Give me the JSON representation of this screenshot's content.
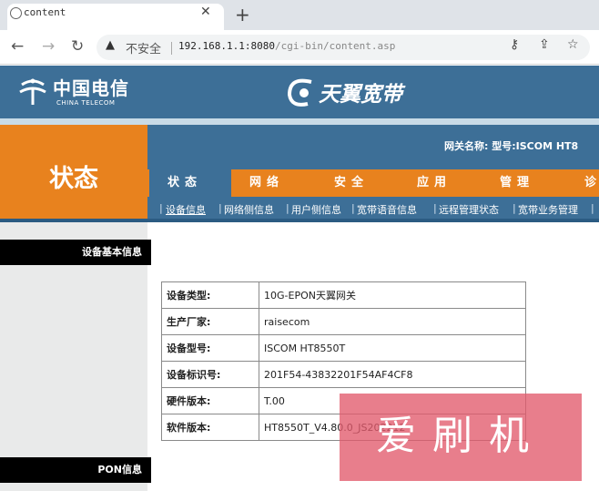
{
  "browser": {
    "tab_title": "content",
    "security_text": "不安全",
    "url_host": "192.168.1.1:8080",
    "url_path": "/cgi-bin/content.asp"
  },
  "header": {
    "logo_cn": "中国电信",
    "logo_en": "CHINA TELECOM",
    "brand": "天翼宽带"
  },
  "status_label": "状态",
  "gateway_info": "网关名称:   型号:ISCOM HT8",
  "nav": {
    "tabs": [
      "状态",
      "网络",
      "安全",
      "应用",
      "管理",
      "诊"
    ],
    "subtabs": [
      "设备信息",
      "网络侧信息",
      "用户侧信息",
      "宽带语音信息",
      "远程管理状态",
      "宽带业务管理"
    ]
  },
  "sidebar": {
    "sections": [
      "设备基本信息",
      "PON信息"
    ]
  },
  "device_info": {
    "rows": [
      {
        "label": "设备类型:",
        "value": "10G-EPON天翼网关"
      },
      {
        "label": "生产厂家:",
        "value": "raisecom"
      },
      {
        "label": "设备型号:",
        "value": "ISCOM HT8550T"
      },
      {
        "label": "设备标识号:",
        "value": "201F54-43832201F54AF4CF8"
      },
      {
        "label": "硬件版本:",
        "value": "T.00"
      },
      {
        "label": "软件版本:",
        "value": "HT8550T_V4.80.0_JS202212"
      }
    ]
  },
  "watermark": "爱刷机",
  "colors": {
    "header_blue": "#3d6f97",
    "accent_orange": "#e8821e",
    "watermark_pink": "#e25a6c"
  }
}
